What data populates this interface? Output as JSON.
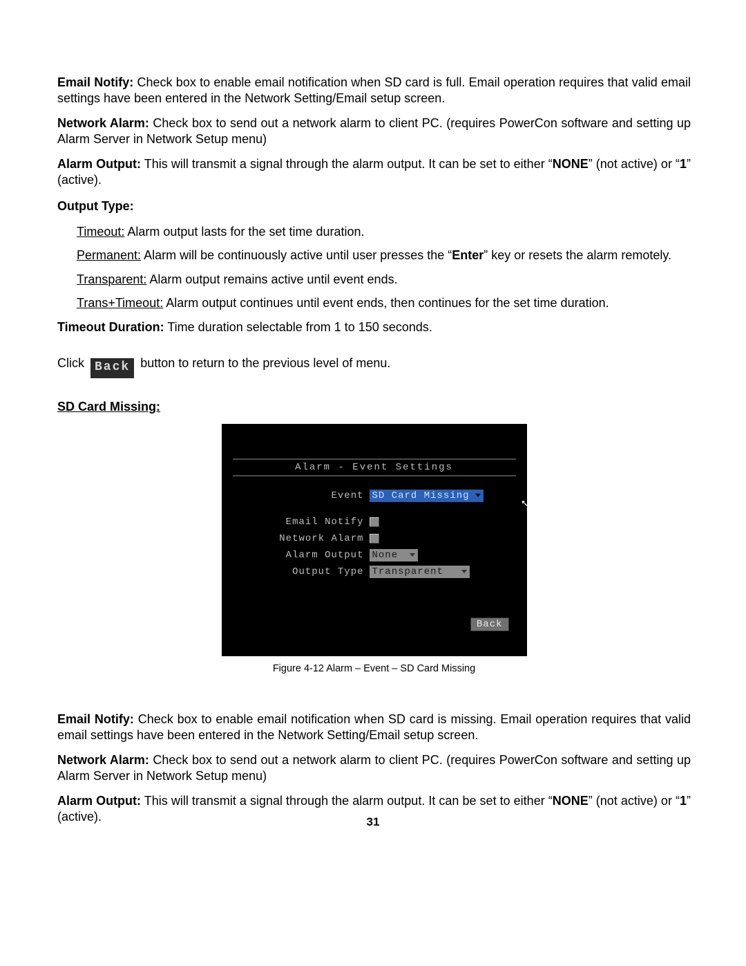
{
  "emailNotify1": {
    "label": "Email Notify:",
    "text": " Check box to enable email notification when SD card is full.  Email operation requires that valid email settings have been entered in the Network Setting/Email setup screen."
  },
  "networkAlarm1": {
    "label": "Network Alarm:",
    "text": " Check box to send out a network alarm to client PC. (requires PowerCon software and setting up Alarm Server in Network Setup menu)"
  },
  "alarmOutput1": {
    "label": "Alarm Output:",
    "textA": " This will transmit a signal through the alarm output. It can be set to either “",
    "none": "NONE",
    "textB": "” (not active) or “",
    "one": "1",
    "textC": "” (active)."
  },
  "outputTypeHeading": "Output Type:",
  "outputTypes": {
    "timeout": {
      "label": "Timeout:",
      "text": " Alarm output lasts for the set time duration."
    },
    "permanent": {
      "label": "Permanent:",
      "textA": " Alarm will be continuously active until user presses the “",
      "enter": "Enter",
      "textB": "” key or resets the alarm remotely."
    },
    "transparent": {
      "label": "Transparent:",
      "text": " Alarm output remains active until event ends."
    },
    "transTimeout": {
      "label": "Trans+Timeout:",
      "text": " Alarm output continues until event ends, then continues for the set time duration."
    }
  },
  "timeoutDuration": {
    "label": "Timeout Duration:",
    "text": " Time duration selectable from 1 to 150 seconds."
  },
  "backLine": {
    "pre": "Click ",
    "btn": "Back",
    "post": " button to return to the previous level of menu."
  },
  "sdHeading": "SD Card Missing:",
  "ui": {
    "title": "Alarm - Event Settings",
    "eventLabel": "Event",
    "eventValue": "SD Card Missing",
    "emailNotify": "Email Notify",
    "networkAlarm": "Network Alarm",
    "alarmOutputLabel": "Alarm Output",
    "alarmOutputValue": "None",
    "outputTypeLabel": "Output Type",
    "outputTypeValue": "Transparent",
    "back": "Back"
  },
  "caption": "Figure 4-12 Alarm – Event – SD Card Missing",
  "emailNotify2": {
    "label": "Email Notify:",
    "text": " Check box to enable email notification when SD card is missing.  Email operation requires that valid email settings have been entered in the Network Setting/Email setup screen."
  },
  "networkAlarm2": {
    "label": "Network Alarm:",
    "text": " Check box to send out a network alarm to client PC. (requires PowerCon software and setting up Alarm Server in Network Setup menu)"
  },
  "alarmOutput2": {
    "label": "Alarm Output:",
    "textA": " This will transmit a signal through the alarm output. It can be set to either “",
    "none": "NONE",
    "textB": "” (not active) or “",
    "one": "1",
    "textC": "” (active)."
  },
  "pageNumber": "31"
}
